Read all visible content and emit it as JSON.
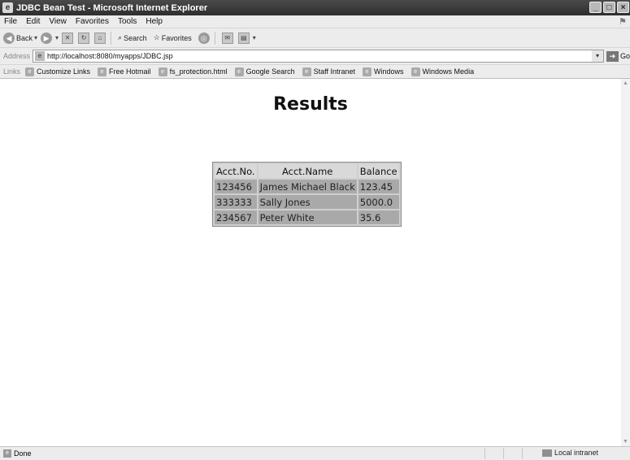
{
  "window": {
    "title": "JDBC Bean Test - Microsoft Internet Explorer",
    "controls": [
      "_",
      "□",
      "×"
    ]
  },
  "menubar": {
    "items": [
      "File",
      "Edit",
      "View",
      "Favorites",
      "Tools",
      "Help"
    ]
  },
  "toolbar": {
    "back_label": "Back",
    "search_label": "Search",
    "favorites_label": "Favorites"
  },
  "addressbar": {
    "label": "Address",
    "url": "http://localhost:8080/myapps/JDBC.jsp",
    "go_label": "Go"
  },
  "linksbar": {
    "label": "Links",
    "items": [
      "Customize Links",
      "Free Hotmail",
      "fs_protection.html",
      "Google Search",
      "Staff Intranet",
      "Windows",
      "Windows Media"
    ]
  },
  "page": {
    "heading": "Results",
    "table": {
      "headers": [
        "Acct.No.",
        "Acct.Name",
        "Balance"
      ],
      "rows": [
        [
          "123456",
          "James Michael Black",
          "123.45"
        ],
        [
          "333333",
          "Sally Jones",
          "5000.0"
        ],
        [
          "234567",
          "Peter White",
          "35.6"
        ]
      ]
    }
  },
  "statusbar": {
    "status": "Done",
    "zone": "Local intranet"
  }
}
